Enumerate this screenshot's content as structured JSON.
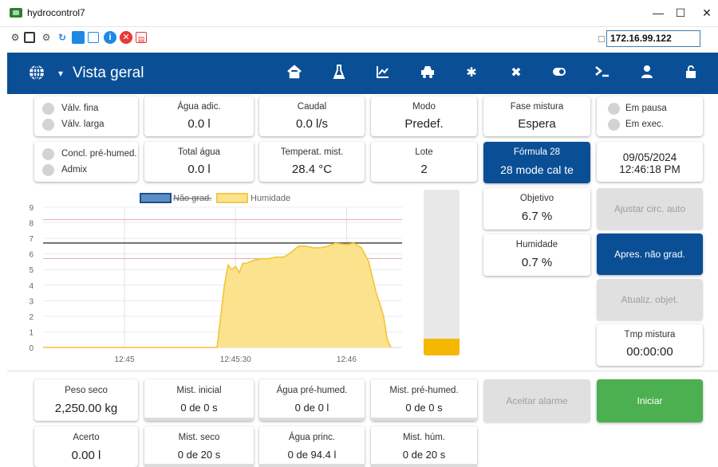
{
  "window": {
    "title": "hydrocontrol7",
    "minimize": "—",
    "maximize": "☐",
    "close": "✕"
  },
  "toolbar": {
    "ip_address": "172.16.99.122"
  },
  "header": {
    "view_title": "Vista geral",
    "globe": "🌐",
    "caret": "▾"
  },
  "indicators_top": [
    {
      "label": "Válv. fina",
      "on": false
    },
    {
      "label": "Válv. larga",
      "on": false
    }
  ],
  "indicators_mid": [
    {
      "label": "Concl. pré-humed.",
      "on": false
    },
    {
      "label": "Admix",
      "on": false
    }
  ],
  "indicators_status": [
    {
      "label": "Em pausa",
      "on": false
    },
    {
      "label": "Em exec.",
      "on": false
    }
  ],
  "stats_row1": [
    {
      "label": "Água adic.",
      "value": "0.0 l"
    },
    {
      "label": "Caudal",
      "value": "0.0 l/s"
    },
    {
      "label": "Modo",
      "value": "Predef."
    },
    {
      "label": "Fase mistura",
      "value": "Espera"
    }
  ],
  "stats_row2": [
    {
      "label": "Total água",
      "value": "0.0 l"
    },
    {
      "label": "Temperat. mist.",
      "value": "28.4 °C"
    },
    {
      "label": "Lote",
      "value": "2"
    }
  ],
  "formula": {
    "label": "Fórmula 28",
    "value": "28 mode cal te"
  },
  "datetime": {
    "date": "09/05/2024",
    "time": "12:46:18 PM"
  },
  "objective": {
    "label": "Objetivo",
    "value": "6.7 %"
  },
  "humidity": {
    "label": "Humidade",
    "value": "0.7 %"
  },
  "actions": {
    "adjust_auto": "Ajustar circ. auto",
    "show_ungraded": "Apres. não grad.",
    "update_objective": "Atualiz. objet.",
    "accept_alarm": "Aceitar alarme",
    "start": "Iniciar"
  },
  "mix_time": {
    "label": "Tmp mistura",
    "value": "00:00:00"
  },
  "bottom_row1": [
    {
      "label": "Peso seco",
      "value": "2,250.00 kg"
    },
    {
      "label": "Mist. inicial",
      "value": "0 de 0 s"
    },
    {
      "label": "Água pré-humed.",
      "value": "0 de 0 l"
    },
    {
      "label": "Mist. pré-humed.",
      "value": "0 de 0 s"
    }
  ],
  "bottom_row2": [
    {
      "label": "Acerto",
      "value": "0.00 l"
    },
    {
      "label": "Mist. seco",
      "value": "0 de 20 s"
    },
    {
      "label": "Água princ.",
      "value": "0 de 94.4 l"
    },
    {
      "label": "Mist. húm.",
      "value": "0 de 20 s"
    }
  ],
  "gauge": {
    "level": 0.1
  },
  "chart_data": {
    "type": "area",
    "legend": [
      "Não grad.",
      "Humidade"
    ],
    "ylim": [
      0,
      9
    ],
    "yticks": [
      "0",
      "1",
      "2",
      "3",
      "4",
      "5",
      "6",
      "7",
      "8",
      "9"
    ],
    "xticks": [
      "12:45",
      "12:45:30",
      "12:46"
    ],
    "xtick_seconds": [
      0,
      30,
      60
    ],
    "xlim_seconds": [
      -22,
      75
    ],
    "grid": true,
    "target_line": 6.7,
    "limit_lines": [
      8.2,
      5.7
    ],
    "series": [
      {
        "name": "Humidade",
        "x_seconds": [
          -22,
          20,
          25,
          26,
          27,
          28,
          29,
          30,
          31,
          32,
          33,
          35,
          37,
          39,
          41,
          43,
          45,
          47,
          49,
          51,
          53,
          55,
          57,
          60,
          62,
          64,
          66,
          67,
          68,
          69,
          70,
          71,
          72
        ],
        "values": [
          0,
          0,
          0,
          2.0,
          4.0,
          5.3,
          5.0,
          5.2,
          4.8,
          5.4,
          5.4,
          5.6,
          5.7,
          5.7,
          5.8,
          5.8,
          6.1,
          6.5,
          6.5,
          6.4,
          6.4,
          6.5,
          6.7,
          6.6,
          6.7,
          6.4,
          5.5,
          4.5,
          3.5,
          2.8,
          2.0,
          0.5,
          0
        ]
      }
    ]
  }
}
